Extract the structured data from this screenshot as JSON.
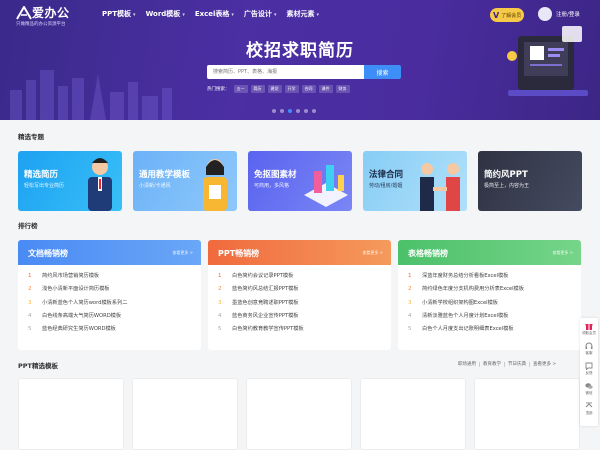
{
  "header": {
    "logo": {
      "name": "爱办公",
      "tagline": "只做精品的办公资源平台"
    },
    "nav": [
      {
        "label": "PPT模板"
      },
      {
        "label": "Word模板"
      },
      {
        "label": "Excel表格"
      },
      {
        "label": "广告设计"
      },
      {
        "label": "素材元素"
      }
    ],
    "vip_label": "了解会员",
    "vip_mark": "V",
    "login_label": "注册/登录"
  },
  "hero": {
    "title": "校招求职简历",
    "search_placeholder": "搜索简历、PPT、表格、海报",
    "search_button": "搜索",
    "hot_label": "热门搜索：",
    "hot_tags": [
      "五一",
      "简历",
      "建党",
      "开学",
      "合同",
      "课件",
      "财务"
    ],
    "active_slide": 2,
    "slide_count": 6
  },
  "featured": {
    "title": "精选专题",
    "cards": [
      {
        "title": "精选简历",
        "subtitle": "轻松写出专业简历",
        "color": "#1aa9f0"
      },
      {
        "title": "通用教学模板",
        "subtitle": "小清新/卡通风",
        "color": "#6ab4f7"
      },
      {
        "title": "免抠图素材",
        "subtitle": "可商用，多风格",
        "color": "#5b6cf0"
      },
      {
        "title": "法律合同",
        "subtitle": "劳动/租房/婚姻",
        "color": "#8fd1f5"
      },
      {
        "title": "简约风PPT",
        "subtitle": "极简至上，内容为王",
        "color": "#3a3f4f"
      }
    ]
  },
  "ranking": {
    "title": "排行榜",
    "more_label": "查看更多 >",
    "boards": [
      {
        "title": "文档畅销榜",
        "color_from": "#4a8af4",
        "color_to": "#6aa7f7",
        "items": [
          "简约风市场营销简历模板",
          "浅色小清新平面设计简历模板",
          "小清新蓝色个人简历word模板系列二",
          "白色线条高端大气简历WORD模板",
          "蓝色经典研究生简历WORD模板"
        ]
      },
      {
        "title": "PPT畅销榜",
        "color_from": "#f06a3e",
        "color_to": "#f59a5c",
        "items": [
          "白色简约会议记录PPT模板",
          "蓝色简约风总结汇报PPT模板",
          "墨蓝色创意竞聘述职PPT模板",
          "蓝色商务风企业宣传PPT模板",
          "白色简约教育教学宣传PPT模板"
        ]
      },
      {
        "title": "表格畅销榜",
        "color_from": "#4cc06a",
        "color_to": "#76d58a",
        "items": [
          "深蓝年度财务总结分析看板Excel模板",
          "简约绿色年度分支机构费用分析表Excel模板",
          "小清新学校组织架构图Excel模板",
          "清新淡雅蓝色个人月度计划Excel模板",
          "白色个人月度支出记账明细表Excel模板"
        ]
      }
    ]
  },
  "ppt_section": {
    "title": "PPT精选模板",
    "tabs": [
      "职场通用",
      "教育教学",
      "节日庆典",
      "查看更多 >"
    ]
  },
  "sidebar_tools": [
    {
      "label": "领取会员",
      "icon": "gift-icon"
    },
    {
      "label": "客服",
      "icon": "service-icon"
    },
    {
      "label": "反馈",
      "icon": "feedback-icon"
    },
    {
      "label": "微信",
      "icon": "wechat-icon"
    },
    {
      "label": "顶部",
      "icon": "top-icon"
    }
  ]
}
